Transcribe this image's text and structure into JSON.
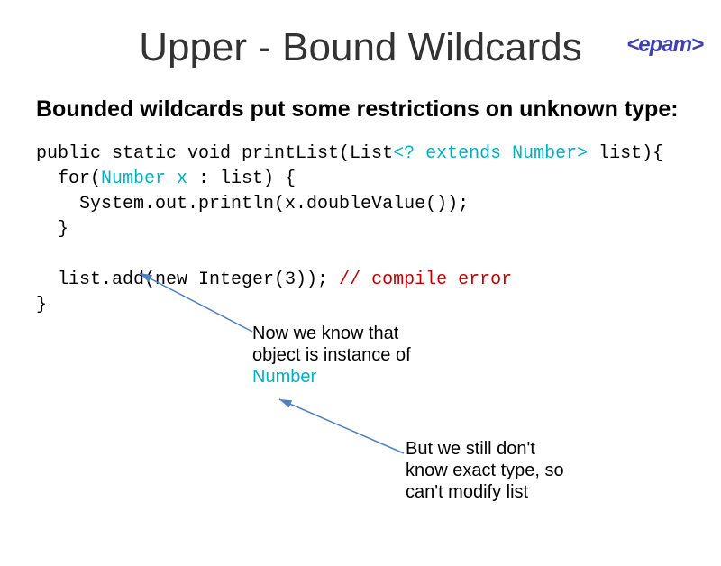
{
  "logo": "<epam>",
  "title": "Upper - Bound Wildcards",
  "subtitle": "Bounded wildcards put some restrictions on unknown type:",
  "code": {
    "line1a": "public static void printList(List",
    "line1b": "<? extends Number>",
    "line1c": " list){",
    "line2a": "  for(",
    "line2b": "Number x",
    "line2c": " : list) {",
    "line3": "    System.out.println(x.doubleValue());",
    "line4": "  }",
    "line5": "",
    "line6a": "  list.add(new Integer(3)); ",
    "line6b": "// compile error",
    "line7": "}"
  },
  "annot1_l1": "Now we know that",
  "annot1_l2": "object is instance of",
  "annot1_l3": "Number",
  "annot2_l1": "But we still don't",
  "annot2_l2": "know exact type, so",
  "annot2_l3": "can't modify list"
}
